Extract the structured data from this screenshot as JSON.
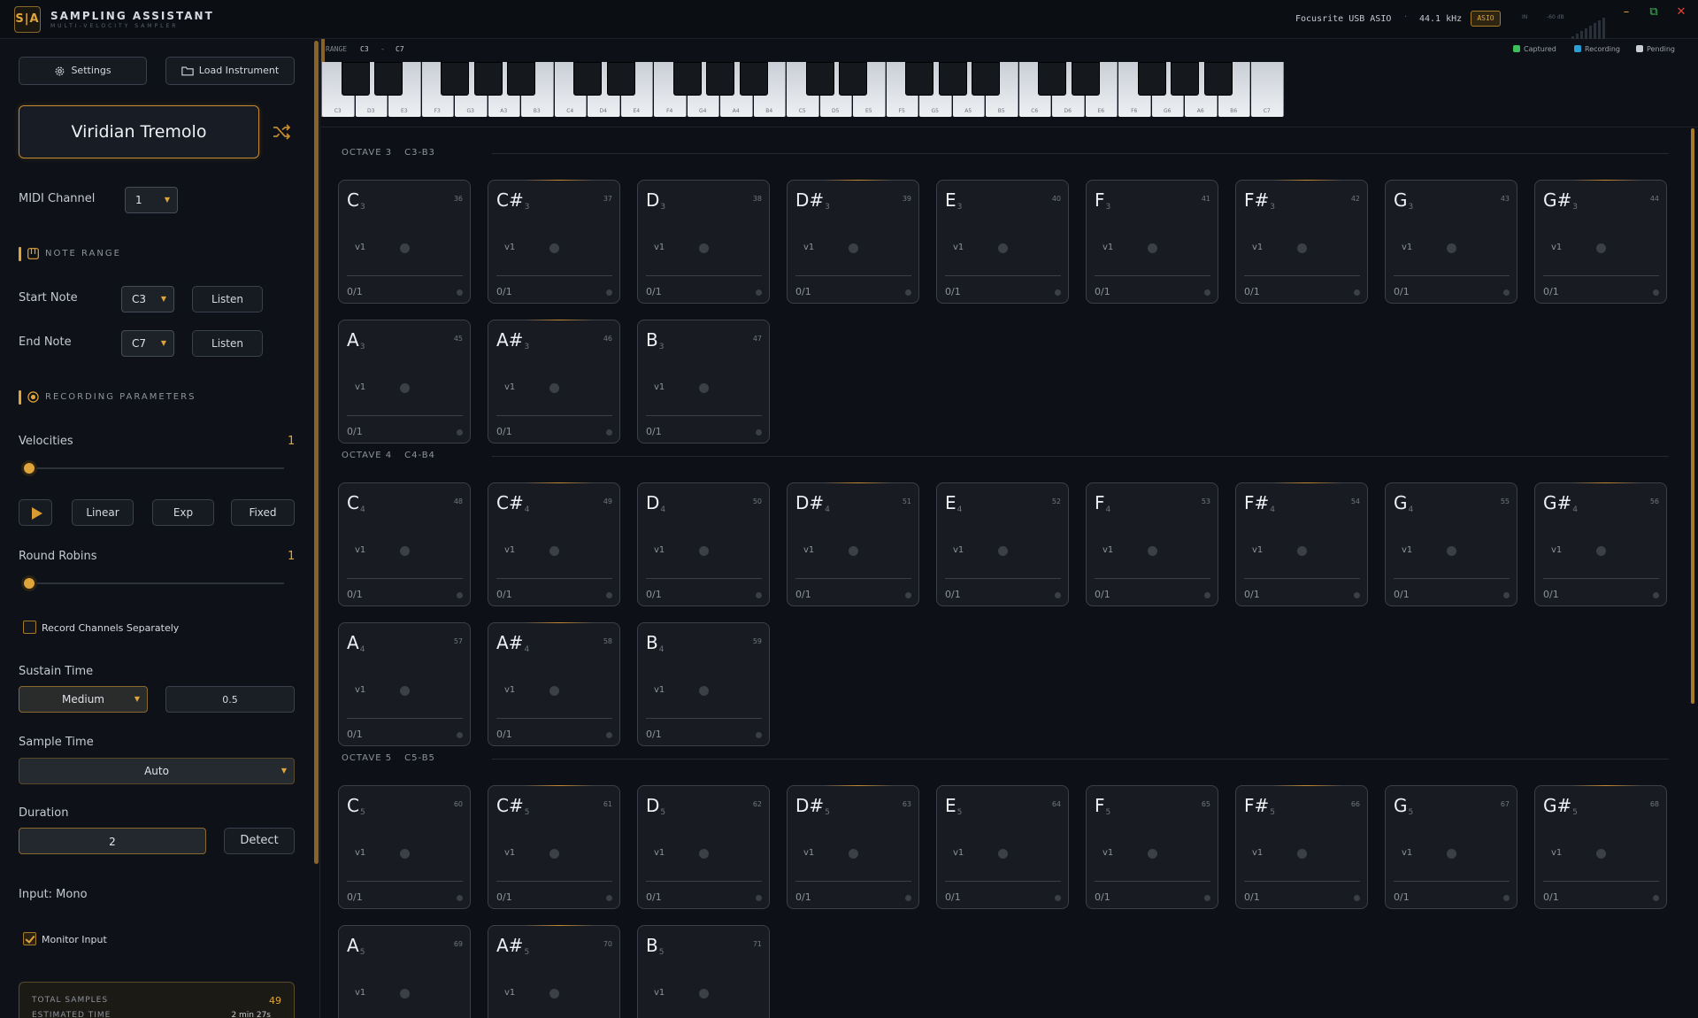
{
  "app": {
    "logo": "S|A",
    "title": "SAMPLING ASSISTANT",
    "subtitle": "MULTI-VELOCITY SAMPLER",
    "audio_device": "Focusrite USB ASIO",
    "separator": "·",
    "sample_rate": "44.1 kHz",
    "driver_badge": "ASIO",
    "meter_in": "IN",
    "meter_db": "-60 dB",
    "accent_color": "#e0a53a",
    "window_controls": {
      "minimize": "–",
      "maximize": "⧉",
      "close": "✕"
    }
  },
  "sidebar": {
    "settings_label": "Settings",
    "load_label": "Load Instrument",
    "instrument_name": "Viridian Tremolo",
    "midi_channel_label": "MIDI Channel",
    "midi_channel_value": "1",
    "note_range": {
      "heading": "NOTE RANGE",
      "start_label": "Start Note",
      "start_value": "C3",
      "end_label": "End Note",
      "end_value": "C7",
      "listen_label": "Listen"
    },
    "recording": {
      "heading": "RECORDING PARAMETERS",
      "velocities_label": "Velocities",
      "velocities_value": "1",
      "curve_linear": "Linear",
      "curve_exp": "Exp",
      "curve_fixed": "Fixed",
      "round_robins_label": "Round Robins",
      "round_robins_value": "1",
      "record_separately_label": "Record Channels Separately",
      "record_separately_checked": false,
      "sustain_label": "Sustain Time",
      "sustain_value": "Medium",
      "sustain_number": "0.5",
      "sample_time_label": "Sample Time",
      "sample_time_value": "Auto",
      "duration_label": "Duration",
      "duration_value": "2",
      "detect_label": "Detect",
      "input_mode": "Input: Mono",
      "monitor_label": "Monitor Input",
      "monitor_checked": true
    },
    "summary": {
      "total_label": "TOTAL SAMPLES",
      "total_value": "49",
      "est_label": "ESTIMATED TIME",
      "est_value": "2 min 27s"
    }
  },
  "keyboard": {
    "range_label": "RANGE",
    "range_start": "C3",
    "range_dash": "-",
    "range_end": "C7",
    "legend": [
      {
        "label": "Captured",
        "color": "#3fbf5a"
      },
      {
        "label": "Recording",
        "color": "#2a9fd6"
      },
      {
        "label": "Pending",
        "color": "#c9ced6"
      }
    ],
    "white_keys": [
      "C3",
      "D3",
      "E3",
      "F3",
      "G3",
      "A3",
      "B3",
      "C4",
      "D4",
      "E4",
      "F4",
      "G4",
      "A4",
      "B4",
      "C5",
      "D5",
      "E5",
      "F5",
      "G5",
      "A5",
      "B5",
      "C6",
      "D6",
      "E6",
      "F6",
      "G6",
      "A6",
      "B6",
      "C7"
    ]
  },
  "grid": {
    "velocity_label": "v1",
    "count_label": "0/1",
    "octaves": [
      {
        "heading": "OCTAVE 3",
        "range": "C3-B3",
        "notes": [
          {
            "name": "C",
            "octave": "3",
            "midi": "36"
          },
          {
            "name": "C#",
            "octave": "3",
            "midi": "37"
          },
          {
            "name": "D",
            "octave": "3",
            "midi": "38"
          },
          {
            "name": "D#",
            "octave": "3",
            "midi": "39"
          },
          {
            "name": "E",
            "octave": "3",
            "midi": "40"
          },
          {
            "name": "F",
            "octave": "3",
            "midi": "41"
          },
          {
            "name": "F#",
            "octave": "3",
            "midi": "42"
          },
          {
            "name": "G",
            "octave": "3",
            "midi": "43"
          },
          {
            "name": "G#",
            "octave": "3",
            "midi": "44"
          },
          {
            "name": "A",
            "octave": "3",
            "midi": "45"
          },
          {
            "name": "A#",
            "octave": "3",
            "midi": "46"
          },
          {
            "name": "B",
            "octave": "3",
            "midi": "47"
          }
        ]
      },
      {
        "heading": "OCTAVE 4",
        "range": "C4-B4",
        "notes": [
          {
            "name": "C",
            "octave": "4",
            "midi": "48"
          },
          {
            "name": "C#",
            "octave": "4",
            "midi": "49"
          },
          {
            "name": "D",
            "octave": "4",
            "midi": "50"
          },
          {
            "name": "D#",
            "octave": "4",
            "midi": "51"
          },
          {
            "name": "E",
            "octave": "4",
            "midi": "52"
          },
          {
            "name": "F",
            "octave": "4",
            "midi": "53"
          },
          {
            "name": "F#",
            "octave": "4",
            "midi": "54"
          },
          {
            "name": "G",
            "octave": "4",
            "midi": "55"
          },
          {
            "name": "G#",
            "octave": "4",
            "midi": "56"
          },
          {
            "name": "A",
            "octave": "4",
            "midi": "57"
          },
          {
            "name": "A#",
            "octave": "4",
            "midi": "58"
          },
          {
            "name": "B",
            "octave": "4",
            "midi": "59"
          }
        ]
      },
      {
        "heading": "OCTAVE 5",
        "range": "C5-B5",
        "notes": [
          {
            "name": "C",
            "octave": "5",
            "midi": "60"
          },
          {
            "name": "C#",
            "octave": "5",
            "midi": "61"
          },
          {
            "name": "D",
            "octave": "5",
            "midi": "62"
          },
          {
            "name": "D#",
            "octave": "5",
            "midi": "63"
          },
          {
            "name": "E",
            "octave": "5",
            "midi": "64"
          },
          {
            "name": "F",
            "octave": "5",
            "midi": "65"
          },
          {
            "name": "F#",
            "octave": "5",
            "midi": "66"
          },
          {
            "name": "G",
            "octave": "5",
            "midi": "67"
          },
          {
            "name": "G#",
            "octave": "5",
            "midi": "68"
          },
          {
            "name": "A",
            "octave": "5",
            "midi": "69"
          },
          {
            "name": "A#",
            "octave": "5",
            "midi": "70"
          },
          {
            "name": "B",
            "octave": "5",
            "midi": "71"
          }
        ]
      }
    ]
  }
}
